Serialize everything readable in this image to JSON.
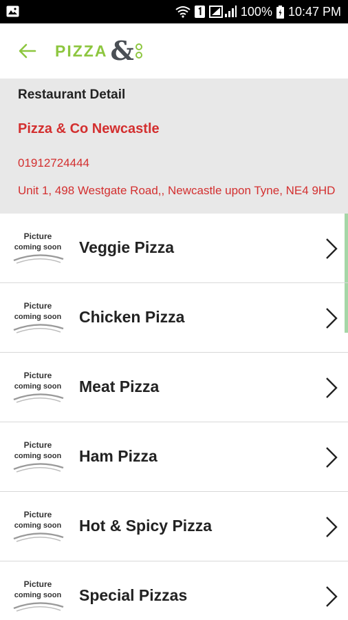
{
  "status_bar": {
    "battery_percent": "100%",
    "time": "10:47 PM",
    "icons": [
      "image-icon",
      "wifi-icon",
      "sim-1-icon",
      "signal-icon",
      "battery-icon"
    ]
  },
  "app_bar": {
    "logo": "PIZZA&co",
    "back_icon": "arrow-left-icon",
    "brand_color": "#8dc63f"
  },
  "restaurant": {
    "section_label": "Restaurant Detail",
    "name": "Pizza & Co Newcastle",
    "phone": "01912724444",
    "address": "Unit 1, 498 Westgate Road,, Newcastle upon Tyne, NE4 9HD",
    "accent_color": "#d32f2f"
  },
  "categories": {
    "placeholder_line1": "Picture",
    "placeholder_line2": "coming soon",
    "items": [
      {
        "label": "Veggie Pizza"
      },
      {
        "label": "Chicken Pizza"
      },
      {
        "label": "Meat Pizza"
      },
      {
        "label": "Ham Pizza"
      },
      {
        "label": "Hot & Spicy Pizza"
      },
      {
        "label": "Special Pizzas"
      }
    ]
  }
}
